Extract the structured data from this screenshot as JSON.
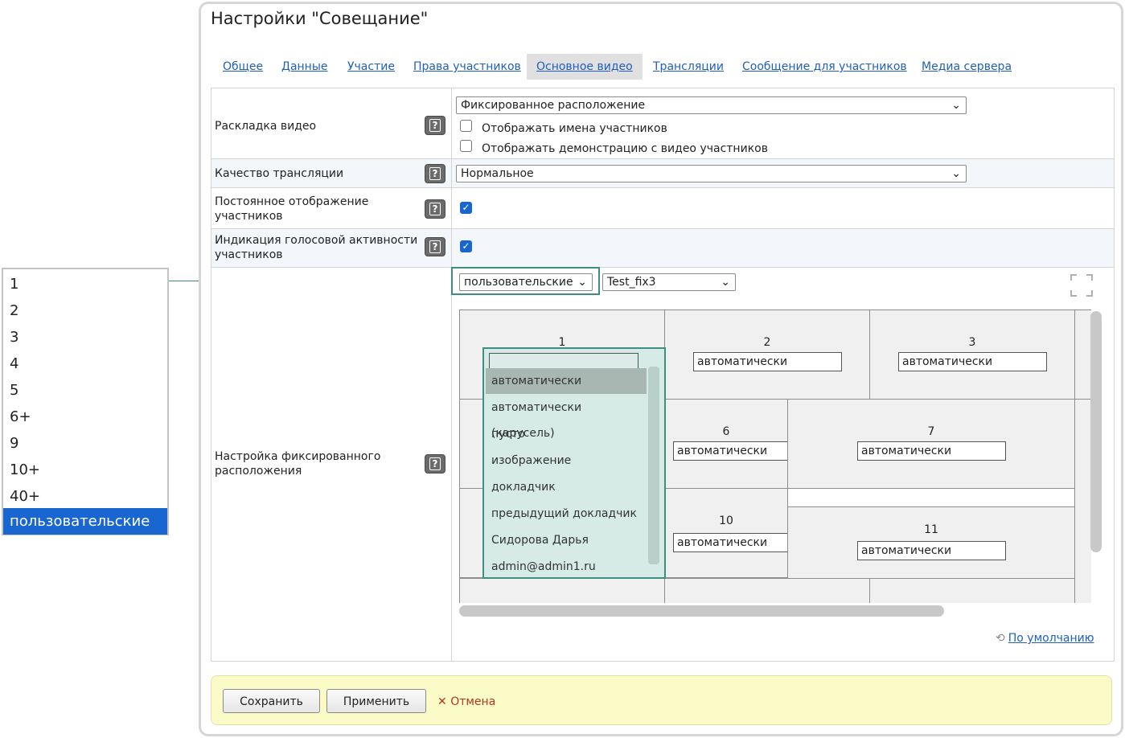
{
  "count_list": {
    "options": [
      "1",
      "2",
      "3",
      "4",
      "5",
      "6+",
      "9",
      "10+",
      "40+",
      "пользовательские"
    ],
    "selected": "пользовательские"
  },
  "panel": {
    "title": "Настройки \"Совещание\"",
    "tabs": [
      "Общее",
      "Данные",
      "Участие",
      "Права участников",
      "Основное видео",
      "Трансляции",
      "Сообщение для участников",
      "Медиа сервера"
    ],
    "active_tab": "Основное видео"
  },
  "form": {
    "layout": {
      "label": "Раскладка видео",
      "select_value": "Фиксированное расположение",
      "show_names_label": "Отображать имена участников",
      "show_names_checked": false,
      "show_demo_label": "Отображать демонстрацию с видео участников",
      "show_demo_checked": false
    },
    "quality": {
      "label": "Качество трансляции",
      "select_value": "Нормальное"
    },
    "permanent": {
      "label": "Постоянное отображение участников",
      "checked": true
    },
    "voice": {
      "label": "Индикация голосовой активности участников",
      "checked": true
    },
    "fixed": {
      "label": "Настройка фиксированного расположения",
      "count_select": "пользовательские",
      "template_select": "Test_fix3",
      "default_link": "По умолчанию"
    }
  },
  "cells": [
    {
      "num": "1",
      "value": ""
    },
    {
      "num": "2",
      "value": "автоматически"
    },
    {
      "num": "3",
      "value": "автоматически"
    },
    {
      "num": "6",
      "value": "автоматически"
    },
    {
      "num": "7",
      "value": "автоматически"
    },
    {
      "num": "10",
      "value": "автоматически"
    },
    {
      "num": "11",
      "value": "автоматически"
    }
  ],
  "cell_dropdown": {
    "options": [
      "автоматически",
      "автоматически (карусель)",
      "пусто",
      "изображение",
      "докладчик",
      "предыдущий докладчик",
      "Сидорова Дарья",
      "admin@admin1.ru"
    ],
    "highlighted": "автоматически"
  },
  "footer": {
    "save": "Сохранить",
    "apply": "Применить",
    "cancel": "Отмена",
    "cancel_icon": "✕"
  },
  "icons": {
    "help": "question-icon",
    "fullscreen": "fullscreen-icon",
    "reset": "reset-icon",
    "chevron": "chevron-down-icon"
  }
}
